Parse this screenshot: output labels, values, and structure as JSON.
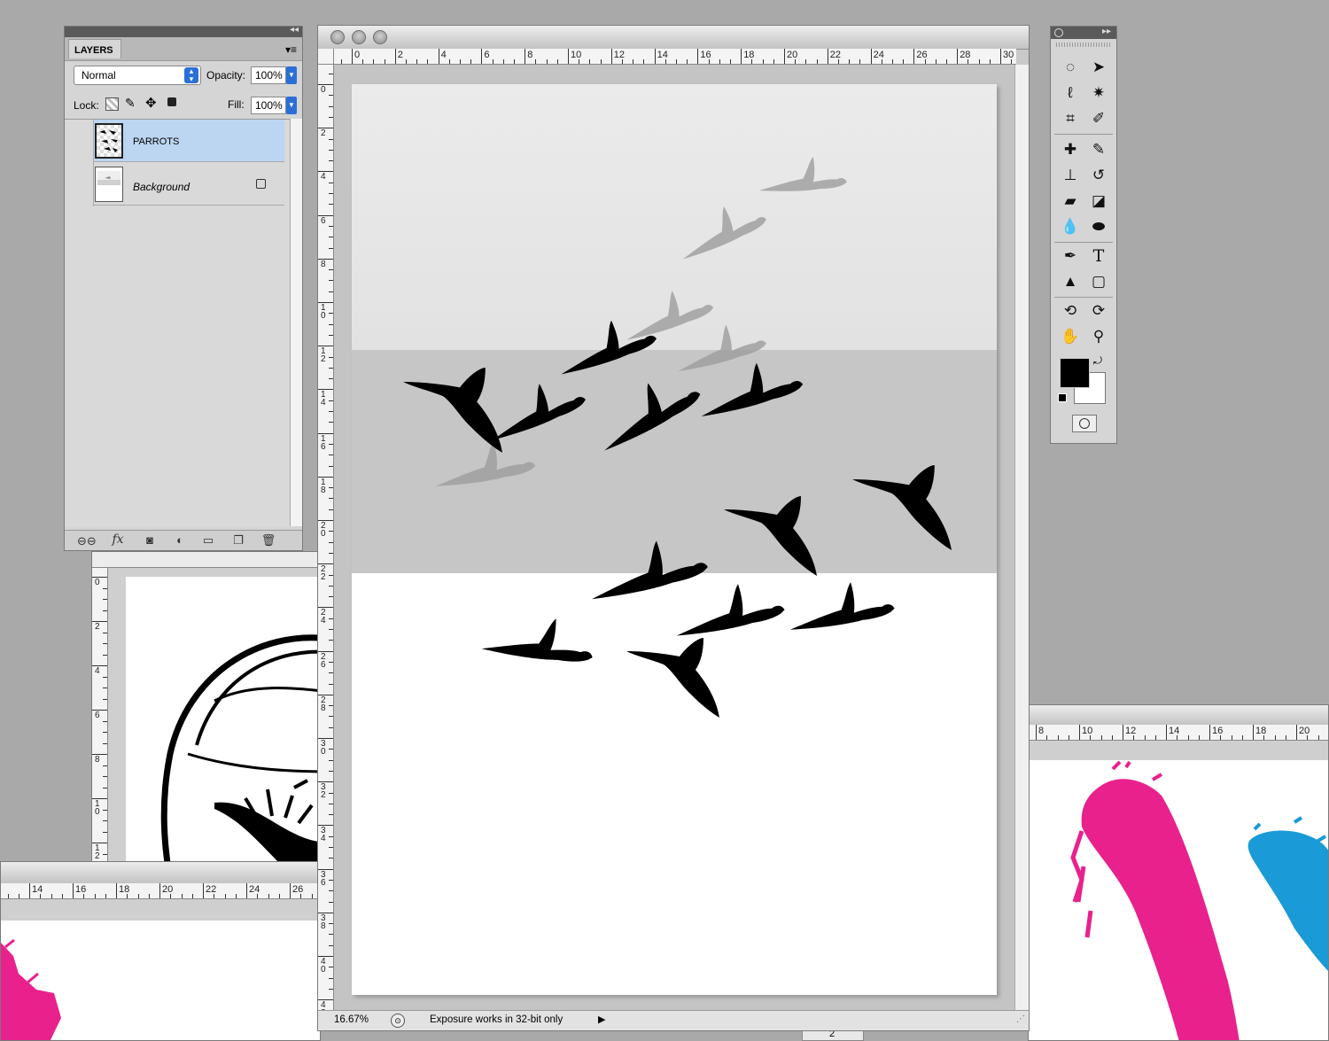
{
  "layers_panel": {
    "tab_label": "LAYERS",
    "blend_mode": "Normal",
    "opacity_label": "Opacity:",
    "opacity_value": "100%",
    "lock_label": "Lock:",
    "fill_label": "Fill:",
    "fill_value": "100%",
    "layers": [
      {
        "name": "PARROTS",
        "selected": true,
        "locked": false
      },
      {
        "name": "Background",
        "selected": false,
        "locked": true
      }
    ],
    "footer_icons": [
      "link-icon",
      "fx-icon",
      "mask-icon",
      "adjustment-icon",
      "folder-icon",
      "new-layer-icon",
      "trash-icon"
    ],
    "fx_text": "fx"
  },
  "main_document": {
    "ruler_h_labels": [
      "0",
      "2",
      "4",
      "6",
      "8",
      "10",
      "12",
      "14",
      "16",
      "18",
      "20",
      "22",
      "24",
      "26",
      "28",
      "30"
    ],
    "ruler_v_labels": [
      "0",
      "2",
      "4",
      "6",
      "8",
      "10",
      "12",
      "14",
      "16",
      "18",
      "20",
      "22",
      "24",
      "26",
      "28",
      "30",
      "32",
      "34",
      "36",
      "38",
      "40",
      "42"
    ],
    "zoom": "16.67%",
    "status_text": "Exposure works in 32-bit only"
  },
  "background_docs": {
    "left_ruler_v_labels": [
      "0",
      "2",
      "4",
      "6",
      "8",
      "10",
      "12"
    ],
    "bottom_left_ruler_h_labels": [
      "14",
      "16",
      "18",
      "20",
      "22",
      "24",
      "26"
    ],
    "right_ruler_h_labels": [
      "8",
      "10",
      "12",
      "14",
      "16",
      "18",
      "20"
    ],
    "bottom_stub_label": "2"
  },
  "colors": {
    "magenta": "#e8218c",
    "cyan": "#1a9ad6",
    "selected_row": "#bcd6f2",
    "accent_blue": "#2b6fd6"
  },
  "toolbox": {
    "tools": [
      "marquee-icon",
      "move-icon",
      "lasso-icon",
      "magic-wand-icon",
      "crop-icon",
      "eyedropper-icon",
      "healing-icon",
      "brush-icon",
      "stamp-icon",
      "history-brush-icon",
      "eraser-icon",
      "paint-bucket-icon",
      "blur-icon",
      "sponge-icon",
      "pen-icon",
      "type-icon",
      "path-select-icon",
      "shape-icon",
      "3d-rotate-icon",
      "3d-orbit-icon",
      "hand-icon",
      "zoom-icon"
    ],
    "type_tool_glyph": "T"
  }
}
